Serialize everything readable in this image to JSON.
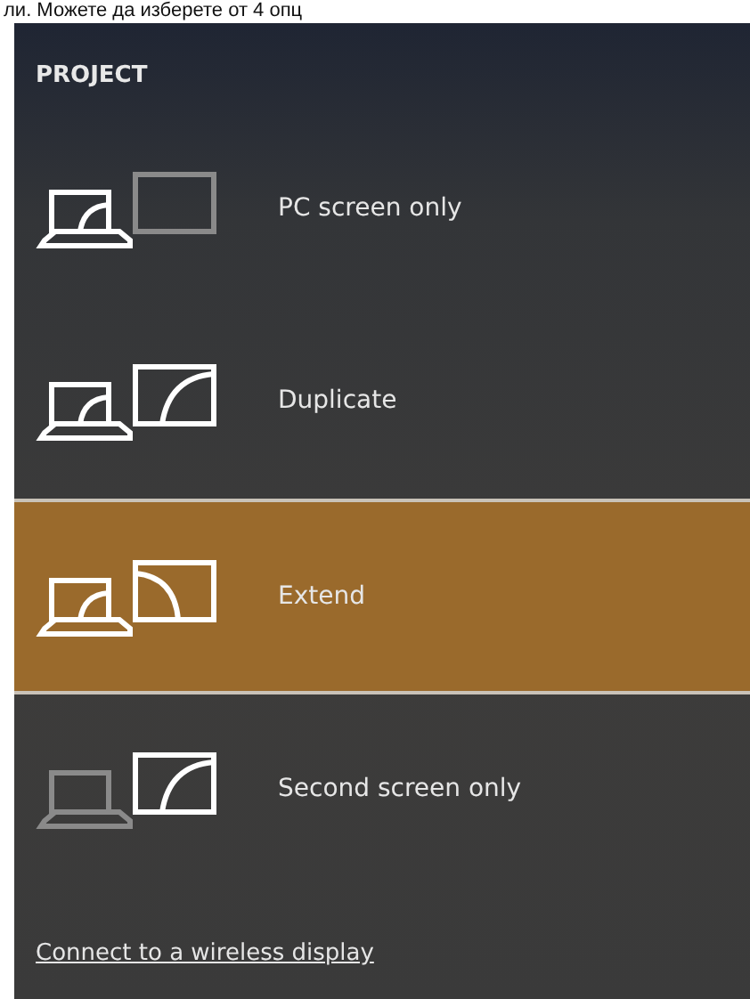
{
  "caption_fragment": "ли. Можете да изберете от 4 опц",
  "panel": {
    "title": "PROJECT",
    "options": [
      {
        "kind": "pc_only",
        "label": "PC screen only",
        "selected": false
      },
      {
        "kind": "duplicate",
        "label": "Duplicate",
        "selected": false
      },
      {
        "kind": "extend",
        "label": "Extend",
        "selected": true
      },
      {
        "kind": "second_only",
        "label": "Second screen only",
        "selected": false
      }
    ],
    "link": "Connect to a wireless display"
  }
}
